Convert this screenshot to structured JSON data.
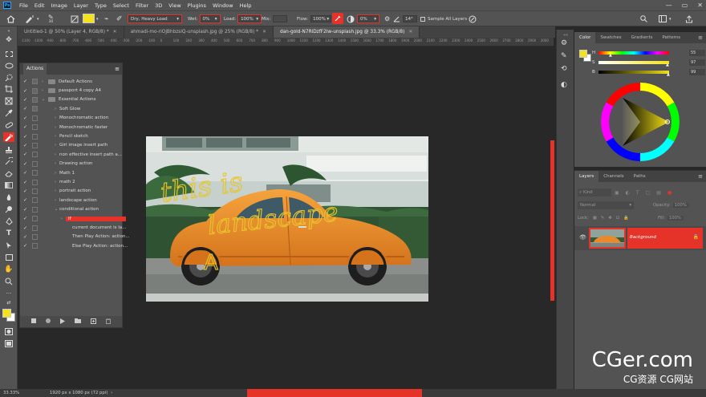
{
  "app": {
    "logo": "Ps"
  },
  "menu": [
    "File",
    "Edit",
    "Image",
    "Layer",
    "Type",
    "Select",
    "Filter",
    "3D",
    "View",
    "Plugins",
    "Window",
    "Help"
  ],
  "window_controls": [
    "—",
    "▭",
    "✕"
  ],
  "options": {
    "brush_size": "30",
    "preset": "Dry, Heavy Load",
    "wet_label": "Wet:",
    "wet_value": "0%",
    "load_label": "Load:",
    "load_value": "100%",
    "mix_label": "Mix:",
    "flow_label": "Flow:",
    "flow_value": "100%",
    "smoothing_value": "0%",
    "angle_value": "14°",
    "sample_all_layers": "Sample All Layers"
  },
  "tabs": [
    {
      "label": "Untitled-1 @ 50% (Layer 4, RGB/8) *",
      "active": false
    },
    {
      "label": "ahmadi-mo-riOjBhbzsiQ-unsplash.jpg @ 25% (RGB/8) *",
      "active": false
    },
    {
      "label": "dan-gold-N7RiDzfF2iw-unsplash.jpg @ 33.3% (RGB/8)",
      "active": true
    }
  ],
  "ruler_ticks": [
    "-1100",
    "-1000",
    "-900",
    "-800",
    "-700",
    "-600",
    "-500",
    "-400",
    "-300",
    "-200",
    "-100",
    "0",
    "100",
    "200",
    "300",
    "400",
    "500",
    "600",
    "700",
    "800",
    "900",
    "1000",
    "1100",
    "1200",
    "1300",
    "1400",
    "1500",
    "1600",
    "1700",
    "1800",
    "1900",
    "2000",
    "2100",
    "2200",
    "2300",
    "2400",
    "2500",
    "2600",
    "2700",
    "2800",
    "2900",
    "3000"
  ],
  "actions_panel": {
    "title": "Actions",
    "items": [
      {
        "label": "Default Actions",
        "level": 0,
        "folder": true,
        "dialog": true
      },
      {
        "label": "passport 4 copy A4",
        "level": 0,
        "folder": true,
        "dialog": true
      },
      {
        "label": "Essential Actions",
        "level": 0,
        "folder": true,
        "expanded": true,
        "dialog": true
      },
      {
        "label": "Soft Glow",
        "level": 1,
        "dialog": true
      },
      {
        "label": "Monochromatic action",
        "level": 1
      },
      {
        "label": "Monochromatic faster",
        "level": 1
      },
      {
        "label": "Pencil sketch",
        "level": 1
      },
      {
        "label": "Girl image insert path",
        "level": 1
      },
      {
        "label": "non effective insert path a...",
        "level": 1
      },
      {
        "label": "Drawing action",
        "level": 1
      },
      {
        "label": "Math 1",
        "level": 1
      },
      {
        "label": "math 2",
        "level": 1
      },
      {
        "label": "portrait action",
        "level": 1
      },
      {
        "label": "landscape action",
        "level": 1
      },
      {
        "label": "conditional action",
        "level": 1,
        "expanded": true
      },
      {
        "label": "If",
        "level": 2,
        "selected": true
      },
      {
        "label": "current document is la...",
        "level": 3
      },
      {
        "label": "Then Play Action: action...",
        "level": 3
      },
      {
        "label": "Else Play Action: action...",
        "level": 3
      }
    ],
    "footer_icons": [
      "stop-icon",
      "record-icon",
      "play-icon",
      "folder-icon",
      "new-action-icon",
      "trash-icon"
    ]
  },
  "canvas_text": {
    "line1": "this is",
    "line2": "landscape",
    "line3": "A"
  },
  "color_panel": {
    "tabs": [
      "Color",
      "Swatches",
      "Gradients",
      "Patterns"
    ],
    "foreground": "#f4e21a",
    "sliders": [
      {
        "label": "H",
        "value": "55"
      },
      {
        "label": "S",
        "value": "97"
      },
      {
        "label": "B",
        "value": "99"
      }
    ]
  },
  "layers_panel": {
    "tabs": [
      "Layers",
      "Channels",
      "Paths"
    ],
    "kind_label": "Kind",
    "blend_mode": "Normal",
    "opacity_label": "Opacity:",
    "opacity_value": "100%",
    "lock_label": "Lock:",
    "fill_label": "Fill:",
    "fill_value": "100%",
    "layer_name": "Background"
  },
  "status": {
    "zoom": "33.33%",
    "doc_info": "1920 px x 1080 px (72 ppi)"
  },
  "watermark": {
    "main": "CGer.com",
    "sub": "CG资源 CG网站"
  },
  "colors": {
    "accent_red": "#e5332a",
    "ui_bg": "#535353",
    "canvas_bg": "#282828",
    "foreground_yellow": "#f4e21a"
  }
}
